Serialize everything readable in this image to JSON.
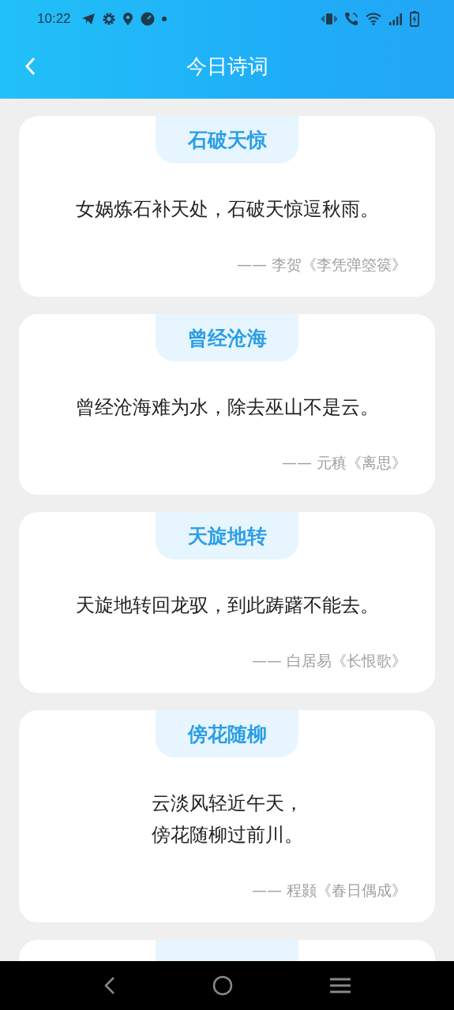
{
  "status_bar": {
    "time": "10:22"
  },
  "header": {
    "title": "今日诗词"
  },
  "poems": [
    {
      "title": "石破天惊",
      "lines": [
        "女娲炼石补天处，石破天惊逗秋雨。"
      ],
      "source": "—— 李贺《李凭弹箜篌》"
    },
    {
      "title": "曾经沧海",
      "lines": [
        "曾经沧海难为水，除去巫山不是云。"
      ],
      "source": "—— 元稹《离思》"
    },
    {
      "title": "天旋地转",
      "lines": [
        "天旋地转回龙驭，到此踌躇不能去。"
      ],
      "source": "—— 白居易《长恨歌》"
    },
    {
      "title": "傍花随柳",
      "lines": [
        "云淡风轻近午天，",
        "傍花随柳过前川。"
      ],
      "source": "—— 程颢《春日偶成》"
    }
  ]
}
